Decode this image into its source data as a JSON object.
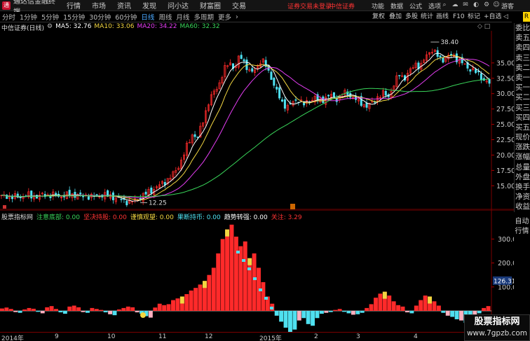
{
  "app": {
    "name": "通达信金融终端",
    "login_notice": "证券交易未登录",
    "broker": "中信证券",
    "guest": "游客"
  },
  "menu": [
    "行情",
    "市场",
    "资讯",
    "发现",
    "问小达",
    "财富圈",
    "交易"
  ],
  "menu_right": [
    "功能",
    "数据",
    "公式",
    "选项"
  ],
  "toolbar": {
    "periods": [
      "分时",
      "1分钟",
      "5分钟",
      "15分钟",
      "30分钟",
      "60分钟",
      "日线",
      "周线",
      "月线",
      "多周期",
      "更多"
    ],
    "active_period": "日线",
    "right_tools": [
      "复权",
      "叠加",
      "多股",
      "统计",
      "画线",
      "F10",
      "标记",
      "+自选"
    ]
  },
  "chart_header": {
    "title": "中信证券(日线)",
    "ma5": "MA5: 32.76",
    "ma10": "MA10: 33.06",
    "ma20": "MA20: 34.22",
    "ma60": "MA60: 32.32"
  },
  "indicator_header": {
    "name": "股票指标网",
    "s1": "注意底部: 0.00",
    "s2": "坚决持股: 0.00",
    "s3": "谨慎观望: 0.00",
    "s4": "果断持币: 0.00",
    "s5": "趋势转强: 0.00",
    "s6": "关注: 3.29"
  },
  "orderbook": [
    "委比",
    "卖五",
    "卖四",
    "卖三",
    "卖二",
    "卖一",
    "买一",
    "买二",
    "买三",
    "买四",
    "买五",
    "现价",
    "涨跌",
    "涨幅",
    "总量",
    "外盘",
    "换手",
    "净资",
    "收益"
  ],
  "side_tabs": {
    "auto": "自动",
    "market": "行情",
    "r": "R"
  },
  "colors": {
    "up": "#ff2a2a",
    "down": "#4fe0f0",
    "ma5": "#ffffff",
    "ma10": "#f2d641",
    "ma20": "#e43df2",
    "ma60": "#39d65a",
    "flat": "#ffb0c0"
  },
  "watermark": {
    "title": "股票指标网",
    "url": "www.7gpzb.com"
  },
  "chart_data": [
    {
      "type": "candlestick",
      "title": "中信证券(日线)",
      "y_ticks": [
        15.0,
        17.5,
        20.0,
        22.5,
        25.0,
        27.5,
        30.0,
        32.5,
        35.0
      ],
      "ylim": [
        11.5,
        40.0
      ],
      "annotations": [
        {
          "label": "38.40",
          "value": 38.4
        },
        {
          "label": "12.25",
          "value": 12.25
        }
      ],
      "x_labels": [
        "2014年",
        "9",
        "10",
        "11",
        "12",
        "2015年",
        "2",
        "3",
        "4"
      ],
      "close_path": [
        13.2,
        13.4,
        13.1,
        13.3,
        13.2,
        13.5,
        13.3,
        13.2,
        13.6,
        13.4,
        13.5,
        13.3,
        13.4,
        13.6,
        13.5,
        13.3,
        13.4,
        13.2,
        13.3,
        13.5,
        13.4,
        13.2,
        12.9,
        12.6,
        12.4,
        12.5,
        13.0,
        13.6,
        14.1,
        14.6,
        15.2,
        15.8,
        16.5,
        17.6,
        19.2,
        21.5,
        23.4,
        22.8,
        25.6,
        28.4,
        30.2,
        31.5,
        33.8,
        35.2,
        34.0,
        36.3,
        34.8,
        33.2,
        34.1,
        35.6,
        34.3,
        32.4,
        30.1,
        28.4,
        27.9,
        28.6,
        29.1,
        28.2,
        28.8,
        29.4,
        28.7,
        29.3,
        29.8,
        29.1,
        29.6,
        30.2,
        29.5,
        29.0,
        28.4,
        27.9,
        28.6,
        29.5,
        30.0,
        29.6,
        31.4,
        33.2,
        32.5,
        33.6,
        35.0,
        34.2,
        36.1,
        37.2,
        36.4,
        35.5,
        35.8,
        36.4,
        35.6,
        34.9,
        34.2,
        33.8,
        33.1,
        32.2,
        31.6
      ]
    },
    {
      "type": "bar",
      "title": "股票指标网",
      "y_ticks": [
        100,
        200,
        300
      ],
      "reference_line": {
        "label": "126.31",
        "value": 126.31
      },
      "ylim": [
        -100,
        380
      ],
      "bars": [
        10,
        14,
        8,
        -5,
        -8,
        6,
        12,
        9,
        -4,
        -10,
        15,
        20,
        8,
        -6,
        -12,
        18,
        22,
        15,
        -5,
        -8,
        12,
        8,
        4,
        -6,
        -14,
        -18,
        6,
        12,
        18,
        15,
        -6,
        -12,
        -22,
        -28,
        14,
        30,
        24,
        28,
        45,
        52,
        60,
        70,
        85,
        96,
        110,
        125,
        150,
        180,
        240,
        300,
        340,
        360,
        310,
        270,
        290,
        220,
        240,
        180,
        120,
        60,
        30,
        -20,
        -45,
        -70,
        -90,
        -78,
        -40,
        -30,
        -55,
        -62,
        -30,
        -12,
        -8,
        -5,
        4,
        8,
        -4,
        -10,
        -16,
        -14,
        -8,
        12,
        28,
        55,
        72,
        80,
        64,
        40,
        24,
        18,
        -6,
        -10,
        22,
        45,
        64,
        60,
        40,
        22,
        -8,
        -20,
        -25,
        -35,
        -40,
        -50,
        -38,
        -28,
        -10,
        12,
        20
      ]
    }
  ]
}
